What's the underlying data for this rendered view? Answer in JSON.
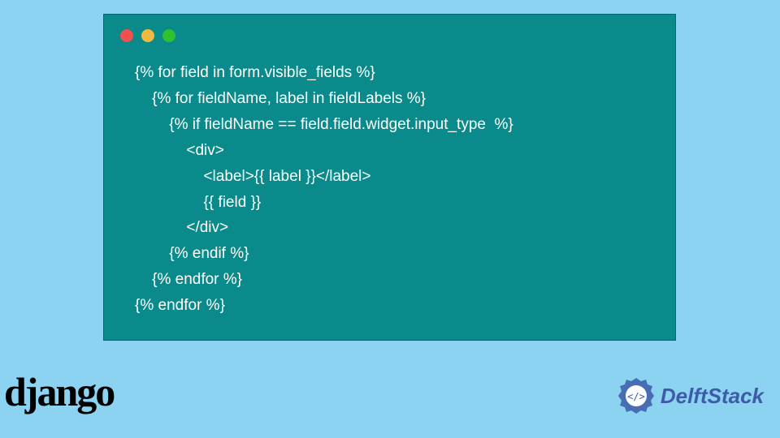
{
  "code": {
    "lines": [
      "{% for field in form.visible_fields %}",
      "    {% for fieldName, label in fieldLabels %}",
      "        {% if fieldName == field.field.widget.input_type  %}",
      "            <div>",
      "                <label>{{ label }}</label>",
      "                {{ field }}",
      "            </div>",
      "        {% endif %}",
      "    {% endfor %}",
      "{% endfor %}"
    ]
  },
  "logos": {
    "django": "django",
    "delftstack": "DelftStack"
  }
}
